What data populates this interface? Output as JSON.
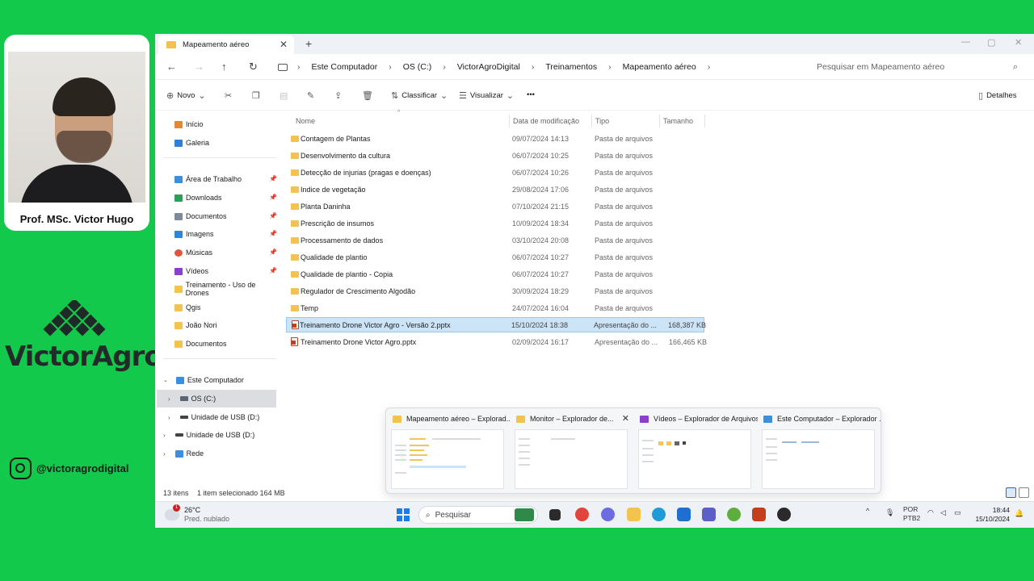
{
  "overlay": {
    "presenter_name": "Prof. MSc. Victor Hugo",
    "logo_text": "VictorAgro",
    "instagram_handle": "@victoragrodigital"
  },
  "window": {
    "tab_title": "Mapeamento aéreo",
    "tab_close": "✕",
    "new_tab": "+",
    "controls": [
      "—",
      "▢",
      "✕"
    ]
  },
  "nav": {
    "back_icon": "←",
    "forward_icon": "→",
    "up_icon": "↑",
    "refresh_icon": "↻",
    "breadcrumbs": [
      "Este Computador",
      "OS (C:)",
      "VictorAgroDigital",
      "Treinamentos",
      "Mapeamento aéreo"
    ],
    "separator": "›",
    "search_placeholder": "Pesquisar em Mapeamento aéreo",
    "search_icon": "⌕"
  },
  "commands": {
    "new": "Novo",
    "sort": "Classificar",
    "view": "Visualizar",
    "more": "•••",
    "details": "Detalhes",
    "icons": [
      "new-icon",
      "cut-icon",
      "copy-icon",
      "paste-icon",
      "rename-icon",
      "share-icon",
      "delete-icon",
      "sort-icon",
      "view-icon",
      "details-icon"
    ]
  },
  "sidebar": {
    "items": [
      {
        "label": "Início",
        "icon": "home-icon",
        "color": "#e08a2e"
      },
      {
        "label": "Galeria",
        "icon": "gallery-icon",
        "color": "#2f7fd8"
      },
      {
        "label": "Área de Trabalho",
        "icon": "desktop-icon",
        "color": "#3a8fe0"
      },
      {
        "label": "Downloads",
        "icon": "download-icon",
        "color": "#2d9d5b"
      },
      {
        "label": "Documentos",
        "icon": "documents-icon",
        "color": "#7d8a99"
      },
      {
        "label": "Imagens",
        "icon": "pictures-icon",
        "color": "#2f86d8"
      },
      {
        "label": "Músicas",
        "icon": "music-icon",
        "color": "#e0553b"
      },
      {
        "label": "Vídeos",
        "icon": "videos-icon",
        "color": "#8a3fd1"
      },
      {
        "label": "Treinamento - Uso de Drones",
        "icon": "folder-icon",
        "color": "#f3c24f"
      },
      {
        "label": "Qgis",
        "icon": "folder-icon",
        "color": "#f3c24f"
      },
      {
        "label": "João Nori",
        "icon": "folder-icon",
        "color": "#f3c24f"
      },
      {
        "label": "Documentos",
        "icon": "folder-icon",
        "color": "#f3c24f"
      },
      {
        "label": "Este Computador",
        "icon": "computer-icon",
        "color": "#3a8fe0"
      },
      {
        "label": "OS (C:)",
        "icon": "drive-icon",
        "color": "#5a6675"
      },
      {
        "label": "Unidade de USB (D:)",
        "icon": "usb-drive-icon",
        "color": "#444444"
      },
      {
        "label": "Unidade de USB (D:)",
        "icon": "usb-drive-icon",
        "color": "#444444"
      },
      {
        "label": "Rede",
        "icon": "network-icon",
        "color": "#3a8fe0"
      }
    ]
  },
  "columns": {
    "name": "Nome",
    "modified": "Data de modificação",
    "type": "Tipo",
    "size": "Tamanho"
  },
  "files": [
    {
      "name": "Contagem de Plantas",
      "modified": "09/07/2024 14:13",
      "type": "Pasta de arquivos",
      "size": ""
    },
    {
      "name": "Desenvolvimento da cultura",
      "modified": "06/07/2024 10:25",
      "type": "Pasta de arquivos",
      "size": ""
    },
    {
      "name": "Detecção de injurias (pragas e doenças)",
      "modified": "06/07/2024 10:26",
      "type": "Pasta de arquivos",
      "size": ""
    },
    {
      "name": "Indice de vegetação",
      "modified": "29/08/2024 17:06",
      "type": "Pasta de arquivos",
      "size": ""
    },
    {
      "name": "Planta Daninha",
      "modified": "07/10/2024 21:15",
      "type": "Pasta de arquivos",
      "size": ""
    },
    {
      "name": "Prescrição de insumos",
      "modified": "10/09/2024 18:34",
      "type": "Pasta de arquivos",
      "size": ""
    },
    {
      "name": "Processamento de dados",
      "modified": "03/10/2024 20:08",
      "type": "Pasta de arquivos",
      "size": ""
    },
    {
      "name": "Qualidade de plantio",
      "modified": "06/07/2024 10:27",
      "type": "Pasta de arquivos",
      "size": ""
    },
    {
      "name": "Qualidade de plantio - Copia",
      "modified": "06/07/2024 10:27",
      "type": "Pasta de arquivos",
      "size": ""
    },
    {
      "name": "Regulador de Crescimento Algodão",
      "modified": "30/09/2024 18:29",
      "type": "Pasta de arquivos",
      "size": ""
    },
    {
      "name": "Temp",
      "modified": "24/07/2024 16:04",
      "type": "Pasta de arquivos",
      "size": ""
    },
    {
      "name": "Treinamento Drone Victor Agro - Versão 2.pptx",
      "modified": "15/10/2024 18:38",
      "type": "Apresentação do ...",
      "size": "168,387 KB"
    },
    {
      "name": "Treinamento Drone Victor Agro.pptx",
      "modified": "02/09/2024 16:17",
      "type": "Apresentação do ...",
      "size": "166,465 KB"
    }
  ],
  "status": {
    "count": "13 itens",
    "selection": "1 item selecionado  164 MB"
  },
  "previews": [
    {
      "title": "Mapeamento aéreo – Explorad...",
      "icon": "folder-icon",
      "color": "#f3c24f"
    },
    {
      "title": "Monitor – Explorador de...",
      "icon": "folder-icon",
      "color": "#f3c24f",
      "close": "✕"
    },
    {
      "title": "Vídeos – Explorador de Arquivos",
      "icon": "videos-icon",
      "color": "#8a3fd1"
    },
    {
      "title": "Este Computador – Explorador ...",
      "icon": "computer-icon",
      "color": "#3a8fe0"
    }
  ],
  "taskbar": {
    "weather_temp": "26°C",
    "weather_desc": "Pred. nublado",
    "weather_badge": "1",
    "search_label": "Pesquisar",
    "search_icon": "⌕",
    "lang_1": "POR",
    "lang_2": "PTB2",
    "time": "18:44",
    "date": "15/10/2024",
    "tray_chevron": "^",
    "apps": [
      {
        "icon": "terminal-icon",
        "color": "#2b2b2b"
      },
      {
        "icon": "chrome-icon",
        "color": "#e0443a"
      },
      {
        "icon": "copilot-icon",
        "color": "#6b6ce0"
      },
      {
        "icon": "file-explorer-icon",
        "color": "#f3c24f"
      },
      {
        "icon": "edge-icon",
        "color": "#1f9bd8"
      },
      {
        "icon": "store-icon",
        "color": "#1f6fd0"
      },
      {
        "icon": "teams-icon",
        "color": "#5b5fc7"
      },
      {
        "icon": "qgis-icon",
        "color": "#5fae3d"
      },
      {
        "icon": "powerpoint-icon",
        "color": "#c43e1c"
      },
      {
        "icon": "obs-icon",
        "color": "#2a2a2a"
      }
    ]
  }
}
